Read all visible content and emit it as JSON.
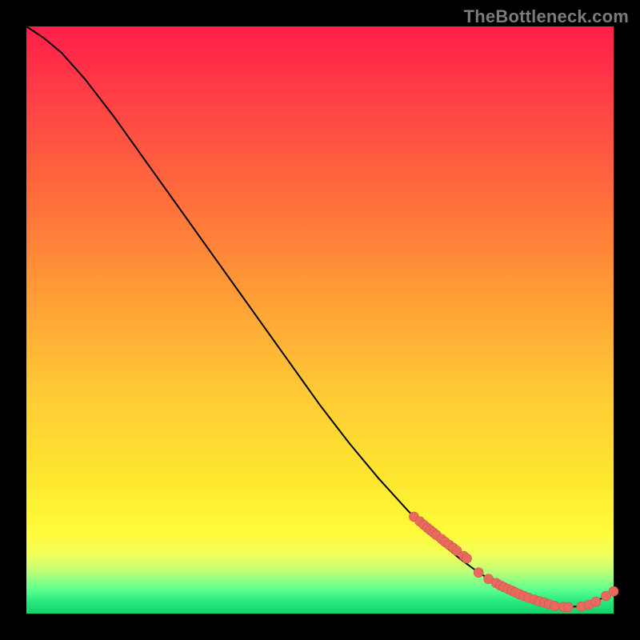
{
  "watermark": "TheBottleneck.com",
  "colors": {
    "dot_fill": "#e86a5e",
    "dot_stroke": "#c9564a",
    "curve": "#000000",
    "bg_black": "#000000"
  },
  "chart_data": {
    "type": "line",
    "title": "",
    "xlabel": "",
    "ylabel": "",
    "xlim": [
      0,
      100
    ],
    "ylim": [
      0,
      100
    ],
    "grid": false,
    "series": [
      {
        "name": "bottleneck-curve",
        "x": [
          0,
          3,
          6,
          10,
          15,
          20,
          25,
          30,
          35,
          40,
          45,
          50,
          55,
          60,
          65,
          70,
          74,
          77,
          80,
          83,
          86,
          88,
          90,
          92,
          95,
          98,
          100
        ],
        "y": [
          100,
          98,
          95.5,
          91,
          84.5,
          77.5,
          70.5,
          63.5,
          56.5,
          49.5,
          42.5,
          35.5,
          29,
          23,
          17.5,
          12.5,
          9.2,
          7,
          5.2,
          3.6,
          2.4,
          1.7,
          1.3,
          1.1,
          1.3,
          2.6,
          3.8
        ]
      }
    ],
    "highlight_points": {
      "name": "cluster-dots",
      "x": [
        66,
        67,
        67.7,
        68.3,
        68.8,
        69.3,
        69.8,
        70.7,
        71.3,
        72,
        72.7,
        73.3,
        74.5,
        75,
        77,
        78.7,
        80,
        80.7,
        81.3,
        82,
        82.7,
        83.3,
        84,
        84.7,
        85.5,
        86.5,
        87.3,
        88.2,
        89,
        90,
        91.5,
        92.3,
        94.5,
        95.8,
        97,
        98.7,
        100
      ],
      "y": [
        16.5,
        15.7,
        15.1,
        14.6,
        14.2,
        13.8,
        13.4,
        12.7,
        12.2,
        11.7,
        11.2,
        10.7,
        9.8,
        9.4,
        7.0,
        5.9,
        5.2,
        4.8,
        4.5,
        4.2,
        3.9,
        3.6,
        3.3,
        3.0,
        2.7,
        2.4,
        2.1,
        1.9,
        1.6,
        1.3,
        1.15,
        1.1,
        1.2,
        1.5,
        2.0,
        3.0,
        3.8
      ],
      "radius": 6
    }
  }
}
